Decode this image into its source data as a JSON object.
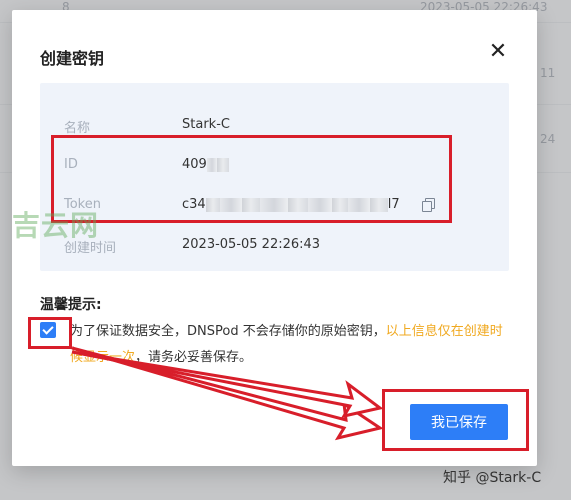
{
  "background": {
    "rows": [
      {
        "col1": "8",
        "col2": "2023-05-05 22:26:43"
      },
      {
        "col1": "",
        "col2": "11"
      },
      {
        "col1": "",
        "col2": "24"
      }
    ]
  },
  "dialog": {
    "title": "创建密钥",
    "close_label": "✕",
    "fields": [
      {
        "key": "名称",
        "value": "Stark-C"
      },
      {
        "key": "ID",
        "value_prefix": "409"
      },
      {
        "key": "Token",
        "value_prefix": "c34",
        "value_suffix": "l7"
      },
      {
        "key": "创建时间",
        "value": "2023-05-05 22:26:43"
      }
    ],
    "tips_title": "温馨提示:",
    "tips_text": "为了保证数据安全，DNSPod 不会存储你的原始密钥，",
    "tips_warning": "以上信息仅在创建时候显示一次",
    "tips_end": "，请务必妥善保存。",
    "checkbox_checked": true,
    "save_label": "我已保存"
  },
  "overlay": {
    "watermark": "吉云网",
    "credit": "知乎 @Stark-C"
  },
  "colors": {
    "primary": "#2d7ef7",
    "warning": "#f0a920",
    "annotation_red": "#d81e2a"
  }
}
